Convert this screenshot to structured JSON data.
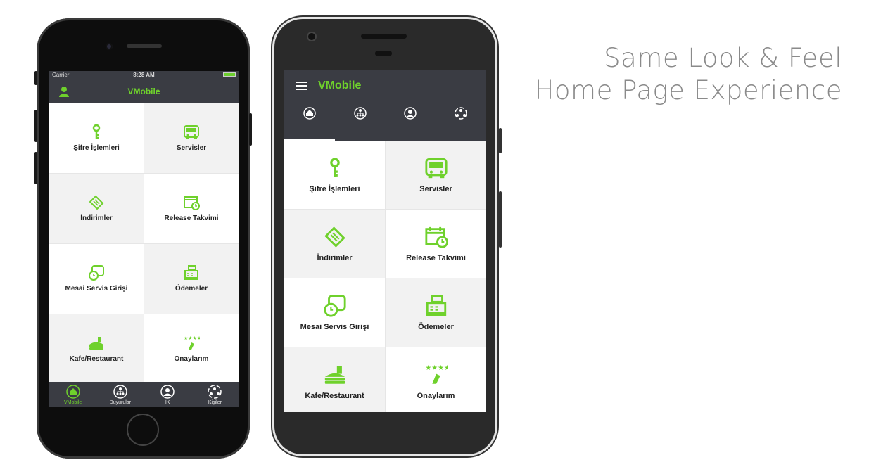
{
  "headline": {
    "line1": "Same Look & Feel",
    "line2": "Home Page Experience"
  },
  "colors": {
    "accent": "#6fd12c",
    "bar": "#3a3c43",
    "tile_white": "#ffffff",
    "tile_gray": "#f2f2f2"
  },
  "ios": {
    "status": {
      "carrier": "Carrier",
      "time": "8:28 AM"
    },
    "nav_title": "VMobile",
    "tiles": [
      {
        "label": "Şifre İşlemleri",
        "icon": "key-icon"
      },
      {
        "label": "Servisler",
        "icon": "bus-icon"
      },
      {
        "label": "İndirimler",
        "icon": "coupon-icon"
      },
      {
        "label": "Release Takvimi",
        "icon": "calendar-clock-icon"
      },
      {
        "label": "Mesai Servis Girişi",
        "icon": "bus-clock-icon"
      },
      {
        "label": "Ödemeler",
        "icon": "cash-register-icon"
      },
      {
        "label": "Kafe/Restaurant",
        "icon": "food-icon"
      },
      {
        "label": "Onaylarım",
        "icon": "approval-stars-icon"
      }
    ],
    "tabs": [
      {
        "label": "VMobile",
        "icon": "home-icon",
        "active": true
      },
      {
        "label": "Duyurular",
        "icon": "announcements-icon",
        "active": false
      },
      {
        "label": "İK",
        "icon": "profile-icon",
        "active": false
      },
      {
        "label": "Kişiler",
        "icon": "contacts-icon",
        "active": false
      }
    ]
  },
  "android": {
    "app_title": "VMobile",
    "tabs": [
      "home-icon",
      "announcements-icon",
      "profile-icon",
      "contacts-icon"
    ],
    "tiles": [
      {
        "label": "Şifre İşlemleri",
        "icon": "key-icon"
      },
      {
        "label": "Servisler",
        "icon": "bus-icon"
      },
      {
        "label": "İndirimler",
        "icon": "coupon-icon"
      },
      {
        "label": "Release Takvimi",
        "icon": "calendar-clock-icon"
      },
      {
        "label": "Mesai Servis Girişi",
        "icon": "bus-clock-icon"
      },
      {
        "label": "Ödemeler",
        "icon": "cash-register-icon"
      },
      {
        "label": "Kafe/Restaurant",
        "icon": "food-icon"
      },
      {
        "label": "Onaylarım",
        "icon": "approval-stars-icon"
      }
    ]
  }
}
